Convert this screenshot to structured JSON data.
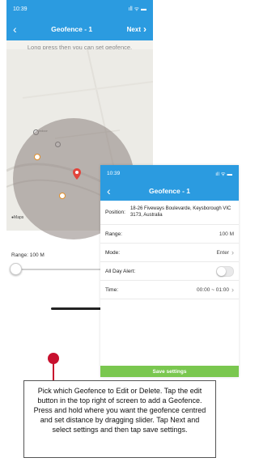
{
  "screen1": {
    "status_time": "10:39",
    "status_icons": "ıll ᯤ ▬",
    "back_icon": "back-chevron-icon",
    "title": "Geofence - 1",
    "next_label": "Next",
    "hint": "Long press then you can set geofence.",
    "maps_logo": "Maps",
    "range_label": "Range: 100 M"
  },
  "screen2": {
    "status_time": "10:39",
    "status_icons": "ıll ᯤ ▬",
    "title": "Geofence - 1",
    "position_label": "Position:",
    "position_value": "18-26 Fiveways Boulevarde, Keysborough VIC 3173, Australia",
    "range_label": "Range:",
    "range_value": "100 M",
    "mode_label": "Mode:",
    "mode_value": "Enter",
    "all_day_label": "All Day Alert:",
    "all_day_on": false,
    "time_label": "Time:",
    "time_value": "00:00 ~ 01:00",
    "save_label": "Save settings"
  },
  "callout": {
    "text": "Pick which Geofence to Edit or Delete. Tap the edit button in the top right of screen to add a Geofence. Press and hold where you want the geofence centred and set distance by dragging slider. Tap Next and select settings and then tap save settings."
  },
  "colors": {
    "nav_blue": "#2b9be0",
    "save_green": "#7ac74f",
    "callout_red": "#c8102e"
  }
}
